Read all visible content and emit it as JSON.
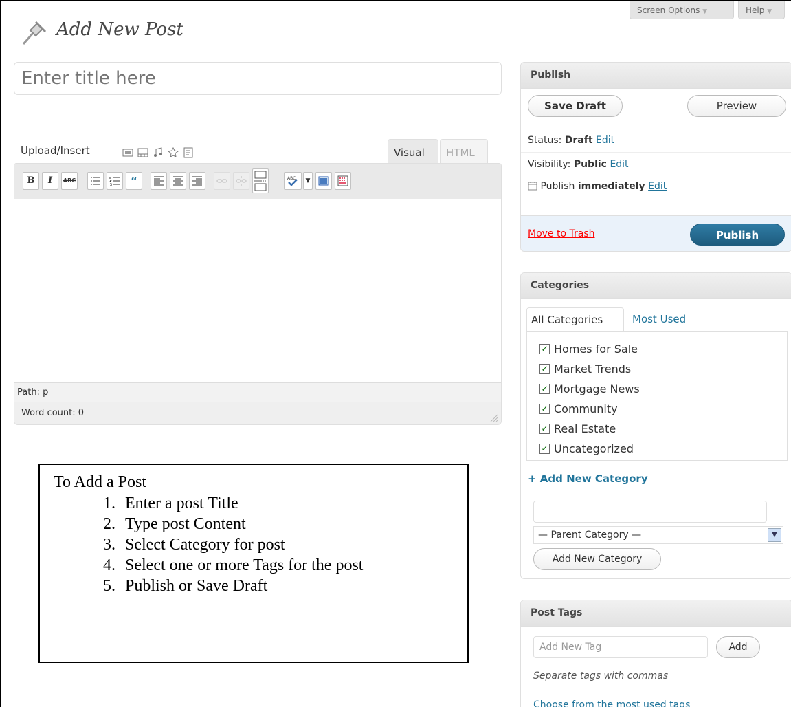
{
  "header": {
    "title": "Add New Post",
    "screen_options": "Screen Options",
    "help": "Help"
  },
  "title_input": {
    "placeholder": "Enter title here"
  },
  "upload": {
    "label": "Upload/Insert"
  },
  "editor": {
    "tab_visual": "Visual",
    "tab_html": "HTML",
    "toolbar": {
      "bold": "B",
      "italic": "I",
      "strike": "ABC"
    },
    "path": "Path: p",
    "word_count": "Word count: 0"
  },
  "callout": {
    "heading": "To Add a Post",
    "steps": [
      "Enter a post Title",
      "Type post Content",
      "Select Category for post",
      "Select one or more Tags for the post",
      "Publish or Save Draft"
    ]
  },
  "publish": {
    "title": "Publish",
    "save_draft": "Save Draft",
    "preview": "Preview",
    "status_label": "Status:",
    "status_value": "Draft",
    "visibility_label": "Visibility:",
    "visibility_value": "Public",
    "schedule_label": "Publish",
    "schedule_value": "immediately",
    "edit": "Edit",
    "move_to_trash": "Move to Trash",
    "publish_button": "Publish"
  },
  "categories": {
    "title": "Categories",
    "tab_all": "All Categories",
    "tab_most": "Most Used",
    "items": [
      "Homes for Sale",
      "Market Trends",
      "Mortgage News",
      "Community",
      "Real Estate",
      "Uncategorized"
    ],
    "add_link": "+ Add New Category",
    "parent_select": "— Parent Category —",
    "add_button": "Add New Category"
  },
  "tags": {
    "title": "Post Tags",
    "placeholder": "Add New Tag",
    "add_button": "Add",
    "hint": "Separate tags with commas",
    "choose_link": "Choose from the most used tags"
  }
}
